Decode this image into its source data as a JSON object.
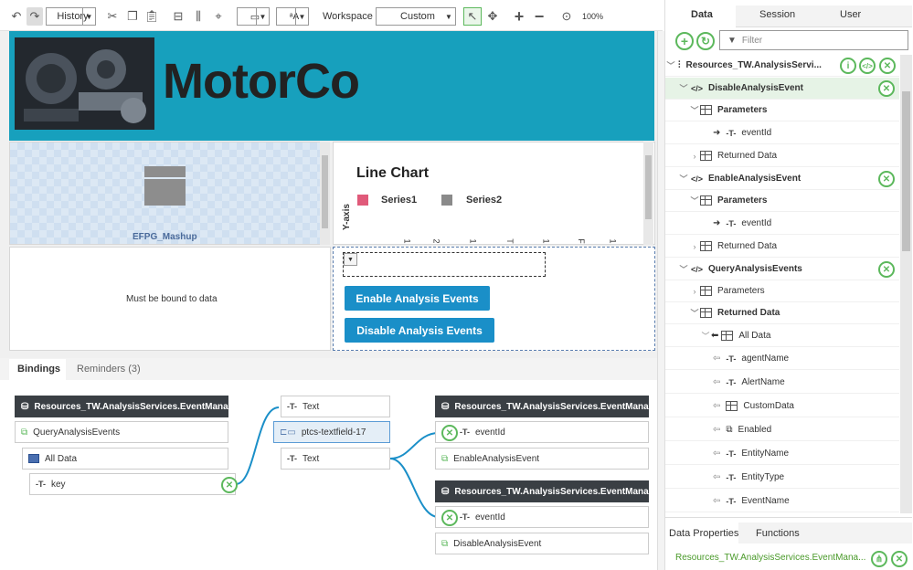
{
  "toolbar": {
    "history_label": "History",
    "workspace_label": "Workspace",
    "workspace_value": "Custom",
    "zoom": "100%"
  },
  "canvas": {
    "brand": "MotorCo",
    "placeholder_label": "EFPG_Mashup",
    "chart_title": "Line Chart",
    "legend": [
      "Series1",
      "Series2"
    ],
    "y_axis_label": "Y-axis",
    "x_ticks": [
      "1",
      "2",
      "1",
      "T",
      "1",
      "F",
      "1"
    ],
    "bound_text": "Must be bound to data",
    "enable_btn": "Enable Analysis Events",
    "disable_btn": "Disable Analysis Events"
  },
  "colors": {
    "banner": "#17a0bd",
    "button": "#1a8fc8",
    "series1": "#e05a7a",
    "series2": "#8a8a8a",
    "green": "#5cb85c"
  },
  "bindings_tabs": [
    "Bindings",
    "Reminders (3)"
  ],
  "bindings": {
    "source_header": "Resources_TW.AnalysisServices.EventManagem...",
    "source_service": "QueryAnalysisEvents",
    "source_alldata": "All Data",
    "source_key": "key",
    "widget_text1": "Text",
    "widget_name": "ptcs-textfield-17",
    "widget_text2": "Text",
    "target1_header": "Resources_TW.AnalysisServices.EventManagem...",
    "target1_param": "eventId",
    "target1_service": "EnableAnalysisEvent",
    "target2_header": "Resources_TW.AnalysisServices.EventManagem...",
    "target2_param": "eventId",
    "target2_service": "DisableAnalysisEvent"
  },
  "right_panel": {
    "tabs": [
      "Data",
      "Session",
      "User"
    ],
    "filter_placeholder": "Filter",
    "root": "Resources_TW.AnalysisServi...",
    "tree": [
      {
        "label": "DisableAnalysisEvent"
      },
      {
        "label": "Parameters"
      },
      {
        "label": "eventId"
      },
      {
        "label": "Returned Data"
      },
      {
        "label": "EnableAnalysisEvent"
      },
      {
        "label": "Parameters"
      },
      {
        "label": "eventId"
      },
      {
        "label": "Returned Data"
      },
      {
        "label": "QueryAnalysisEvents"
      },
      {
        "label": "Parameters"
      },
      {
        "label": "Returned Data"
      },
      {
        "label": "All Data"
      },
      {
        "label": "agentName"
      },
      {
        "label": "AlertName"
      },
      {
        "label": "CustomData"
      },
      {
        "label": "Enabled"
      },
      {
        "label": "EntityName"
      },
      {
        "label": "EntityType"
      },
      {
        "label": "EventName"
      }
    ],
    "bottom_tabs": [
      "Data Properties",
      "Functions"
    ],
    "footer_text": "Resources_TW.AnalysisServices.EventMana..."
  }
}
